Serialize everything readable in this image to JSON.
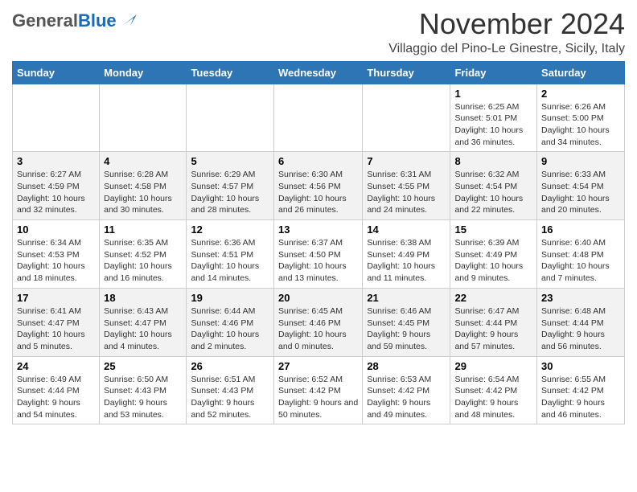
{
  "logo": {
    "general": "General",
    "blue": "Blue"
  },
  "title": "November 2024",
  "location": "Villaggio del Pino-Le Ginestre, Sicily, Italy",
  "headers": [
    "Sunday",
    "Monday",
    "Tuesday",
    "Wednesday",
    "Thursday",
    "Friday",
    "Saturday"
  ],
  "weeks": [
    [
      {
        "day": "",
        "info": ""
      },
      {
        "day": "",
        "info": ""
      },
      {
        "day": "",
        "info": ""
      },
      {
        "day": "",
        "info": ""
      },
      {
        "day": "",
        "info": ""
      },
      {
        "day": "1",
        "info": "Sunrise: 6:25 AM\nSunset: 5:01 PM\nDaylight: 10 hours and 36 minutes."
      },
      {
        "day": "2",
        "info": "Sunrise: 6:26 AM\nSunset: 5:00 PM\nDaylight: 10 hours and 34 minutes."
      }
    ],
    [
      {
        "day": "3",
        "info": "Sunrise: 6:27 AM\nSunset: 4:59 PM\nDaylight: 10 hours and 32 minutes."
      },
      {
        "day": "4",
        "info": "Sunrise: 6:28 AM\nSunset: 4:58 PM\nDaylight: 10 hours and 30 minutes."
      },
      {
        "day": "5",
        "info": "Sunrise: 6:29 AM\nSunset: 4:57 PM\nDaylight: 10 hours and 28 minutes."
      },
      {
        "day": "6",
        "info": "Sunrise: 6:30 AM\nSunset: 4:56 PM\nDaylight: 10 hours and 26 minutes."
      },
      {
        "day": "7",
        "info": "Sunrise: 6:31 AM\nSunset: 4:55 PM\nDaylight: 10 hours and 24 minutes."
      },
      {
        "day": "8",
        "info": "Sunrise: 6:32 AM\nSunset: 4:54 PM\nDaylight: 10 hours and 22 minutes."
      },
      {
        "day": "9",
        "info": "Sunrise: 6:33 AM\nSunset: 4:54 PM\nDaylight: 10 hours and 20 minutes."
      }
    ],
    [
      {
        "day": "10",
        "info": "Sunrise: 6:34 AM\nSunset: 4:53 PM\nDaylight: 10 hours and 18 minutes."
      },
      {
        "day": "11",
        "info": "Sunrise: 6:35 AM\nSunset: 4:52 PM\nDaylight: 10 hours and 16 minutes."
      },
      {
        "day": "12",
        "info": "Sunrise: 6:36 AM\nSunset: 4:51 PM\nDaylight: 10 hours and 14 minutes."
      },
      {
        "day": "13",
        "info": "Sunrise: 6:37 AM\nSunset: 4:50 PM\nDaylight: 10 hours and 13 minutes."
      },
      {
        "day": "14",
        "info": "Sunrise: 6:38 AM\nSunset: 4:49 PM\nDaylight: 10 hours and 11 minutes."
      },
      {
        "day": "15",
        "info": "Sunrise: 6:39 AM\nSunset: 4:49 PM\nDaylight: 10 hours and 9 minutes."
      },
      {
        "day": "16",
        "info": "Sunrise: 6:40 AM\nSunset: 4:48 PM\nDaylight: 10 hours and 7 minutes."
      }
    ],
    [
      {
        "day": "17",
        "info": "Sunrise: 6:41 AM\nSunset: 4:47 PM\nDaylight: 10 hours and 5 minutes."
      },
      {
        "day": "18",
        "info": "Sunrise: 6:43 AM\nSunset: 4:47 PM\nDaylight: 10 hours and 4 minutes."
      },
      {
        "day": "19",
        "info": "Sunrise: 6:44 AM\nSunset: 4:46 PM\nDaylight: 10 hours and 2 minutes."
      },
      {
        "day": "20",
        "info": "Sunrise: 6:45 AM\nSunset: 4:46 PM\nDaylight: 10 hours and 0 minutes."
      },
      {
        "day": "21",
        "info": "Sunrise: 6:46 AM\nSunset: 4:45 PM\nDaylight: 9 hours and 59 minutes."
      },
      {
        "day": "22",
        "info": "Sunrise: 6:47 AM\nSunset: 4:44 PM\nDaylight: 9 hours and 57 minutes."
      },
      {
        "day": "23",
        "info": "Sunrise: 6:48 AM\nSunset: 4:44 PM\nDaylight: 9 hours and 56 minutes."
      }
    ],
    [
      {
        "day": "24",
        "info": "Sunrise: 6:49 AM\nSunset: 4:44 PM\nDaylight: 9 hours and 54 minutes."
      },
      {
        "day": "25",
        "info": "Sunrise: 6:50 AM\nSunset: 4:43 PM\nDaylight: 9 hours and 53 minutes."
      },
      {
        "day": "26",
        "info": "Sunrise: 6:51 AM\nSunset: 4:43 PM\nDaylight: 9 hours and 52 minutes."
      },
      {
        "day": "27",
        "info": "Sunrise: 6:52 AM\nSunset: 4:42 PM\nDaylight: 9 hours and 50 minutes."
      },
      {
        "day": "28",
        "info": "Sunrise: 6:53 AM\nSunset: 4:42 PM\nDaylight: 9 hours and 49 minutes."
      },
      {
        "day": "29",
        "info": "Sunrise: 6:54 AM\nSunset: 4:42 PM\nDaylight: 9 hours and 48 minutes."
      },
      {
        "day": "30",
        "info": "Sunrise: 6:55 AM\nSunset: 4:42 PM\nDaylight: 9 hours and 46 minutes."
      }
    ]
  ]
}
